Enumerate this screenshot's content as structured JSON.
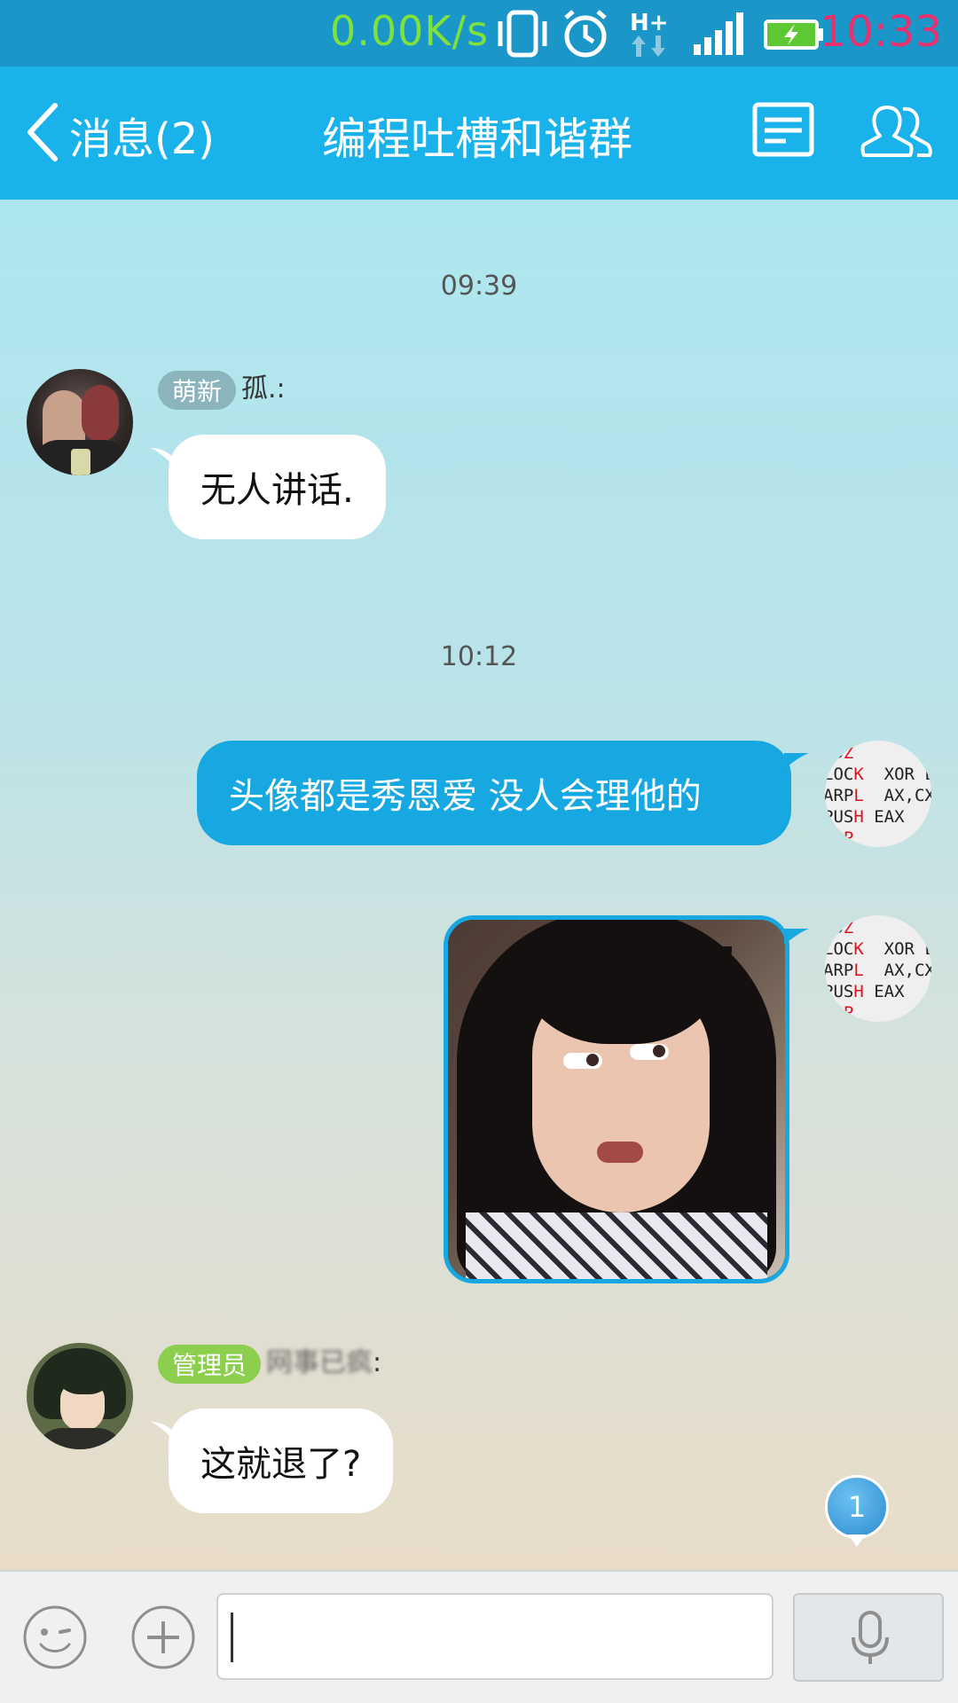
{
  "status_bar": {
    "net_speed": "0.00K/s",
    "time": "10:33",
    "icons": [
      "vibrate-icon",
      "alarm-icon",
      "hplus-data-icon",
      "signal-icon",
      "battery-charging-icon"
    ]
  },
  "header": {
    "back_label": "消息(2)",
    "title": "编程吐槽和谐群",
    "actions": [
      "group-notice-icon",
      "group-members-icon"
    ]
  },
  "messages": {
    "time_1": "09:39",
    "msg_1": {
      "badge": "萌新",
      "sender": "孤.:",
      "text": "无人讲话."
    },
    "time_2": "10:12",
    "msg_2": {
      "text": "头像都是秀恩爱 没人会理他的"
    },
    "msg_3": {
      "type": "image"
    },
    "msg_4": {
      "badge": "管理员",
      "sender": "网事已疯",
      "sender_suffix": ":",
      "text": "这就退了?"
    }
  },
  "avatar_code": {
    "lines": [
      [
        "LD",
        "Z",
        ""
      ],
      [
        "LOC",
        "K",
        "  XOR L"
      ],
      [
        "ARP",
        "L",
        "  AX,CX"
      ],
      [
        "PUS",
        "H",
        " EAX"
      ],
      [
        "NO",
        "P",
        ""
      ]
    ]
  },
  "unread_count": "1",
  "input": {
    "value": "",
    "icons": [
      "emoji-icon",
      "plus-icon",
      "microphone-icon"
    ]
  },
  "colors": {
    "header": "#1ab2ea",
    "status_bar": "#1a96c8",
    "outgoing_bubble": "#17a7e1",
    "incoming_bubble": "#ffffff",
    "badge_new": "#8bb4bd",
    "badge_admin": "#8ccf4e",
    "net_speed": "#7ee23a",
    "clock": "#e8316e"
  }
}
